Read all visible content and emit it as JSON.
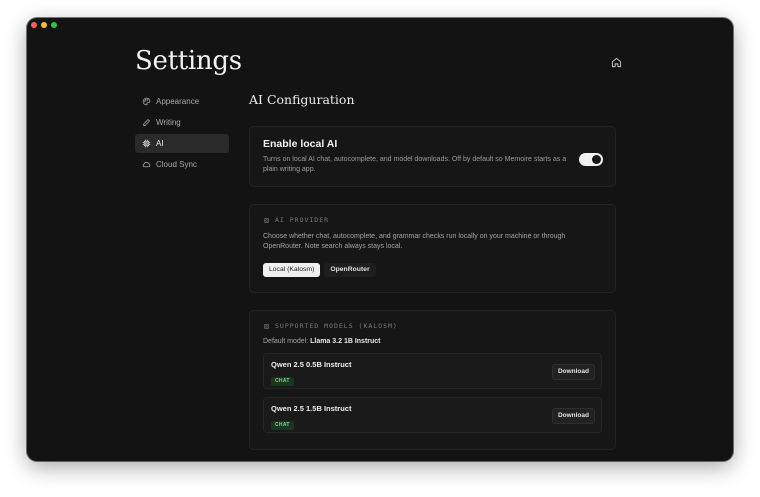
{
  "page": {
    "title": "Settings"
  },
  "sidebar": {
    "items": [
      {
        "label": "Appearance",
        "icon": "palette-icon",
        "active": false
      },
      {
        "label": "Writing",
        "icon": "pen-icon",
        "active": false
      },
      {
        "label": "AI",
        "icon": "chip-icon",
        "active": true
      },
      {
        "label": "Cloud Sync",
        "icon": "cloud-icon",
        "active": false
      }
    ]
  },
  "main": {
    "section_title": "AI Configuration",
    "enable_ai": {
      "title": "Enable local AI",
      "description": "Turns on local AI chat, autocomplete, and model downloads. Off by default so Memoire starts as a plain writing app.",
      "enabled": true
    },
    "provider": {
      "label": "AI PROVIDER",
      "description": "Choose whether chat, autocomplete, and grammar checks run locally on your machine or through OpenRouter. Note search always stays local.",
      "options": [
        "Local (Kalosm)",
        "OpenRouter"
      ],
      "selected": "Local (Kalosm)"
    },
    "models": {
      "label": "SUPPORTED MODELS (KALOSM)",
      "default_prefix": "Default model:",
      "default_model": "Llama 3.2 1B Instruct",
      "items": [
        {
          "name": "Qwen 2.5 0.5B Instruct",
          "badge": "CHAT",
          "action": "Download"
        },
        {
          "name": "Qwen 2.5 1.5B Instruct",
          "badge": "CHAT",
          "action": "Download"
        }
      ]
    }
  },
  "colors": {
    "window_bg": "#131313",
    "card_bg": "#161616",
    "badge_green": "#7bd88f",
    "accent_white": "#f0f0f0"
  }
}
